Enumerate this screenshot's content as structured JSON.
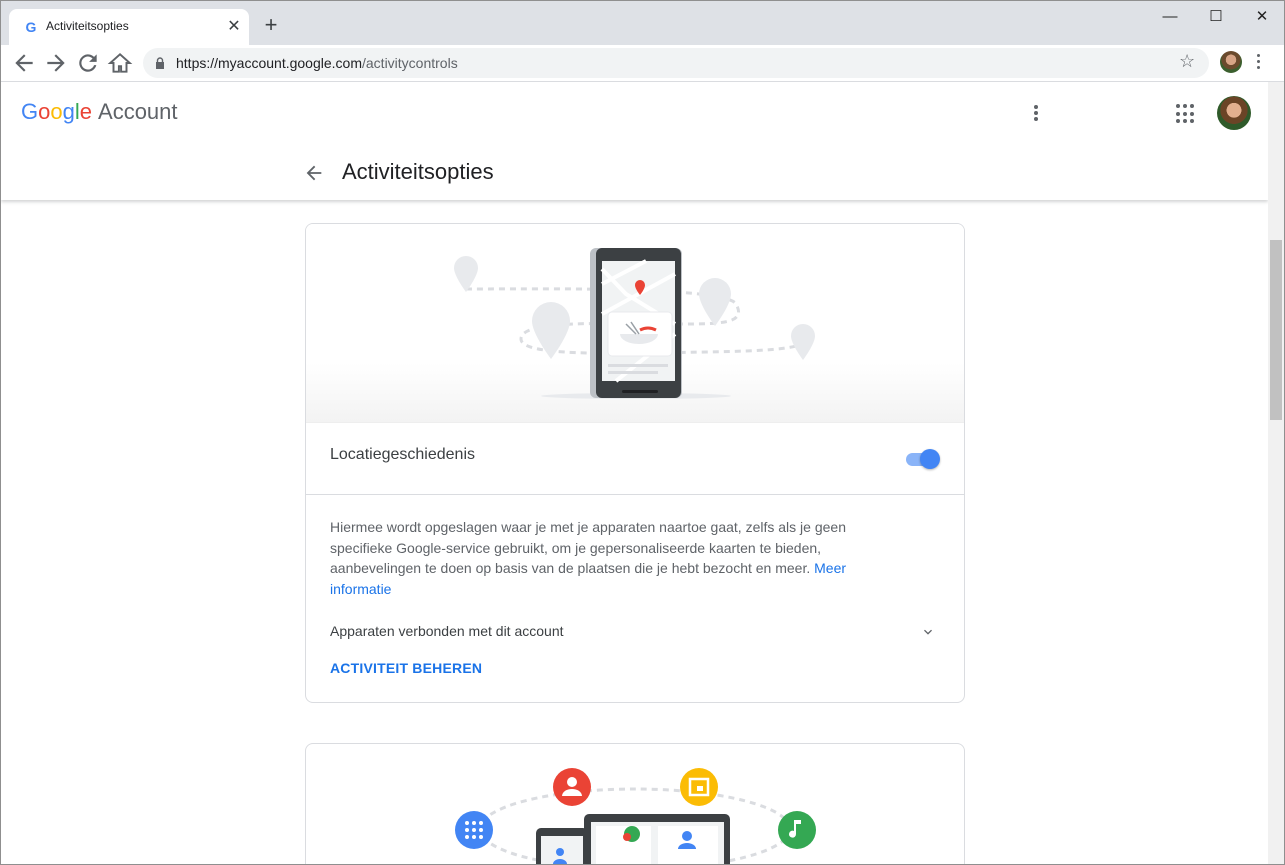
{
  "browser": {
    "tab_title": "Activiteitsopties",
    "tab_favicon": "G",
    "tab_close": "✕",
    "new_tab": "+",
    "window_controls": {
      "minimize": "—",
      "maximize": "☐",
      "close": "✕"
    },
    "url_host": "https://myaccount.google.com",
    "url_path": "/activitycontrols",
    "bookmark_icon": "☆"
  },
  "header": {
    "logo_letters": [
      "G",
      "o",
      "o",
      "g",
      "l",
      "e"
    ],
    "logo_suffix": "Account",
    "page_title": "Activiteitsopties"
  },
  "cards": {
    "location": {
      "title": "Locatiegeschiedenis",
      "toggle_on": true,
      "description": "Hiermee wordt opgeslagen waar je met je apparaten naartoe gaat, zelfs als je geen specifieke Google-service gebruikt, om je gepersonaliseerde kaarten te bieden, aanbevelingen te doen op basis van de plaatsen die je hebt bezocht en meer.",
      "more_link": "Meer informatie",
      "devices_label": "Apparaten verbonden met dit account",
      "manage_label": "ACTIVITEIT BEHEREN"
    }
  },
  "colors": {
    "accent": "#1a73e8",
    "toggle": "#4285f4",
    "icon_red": "#ea4335",
    "icon_yellow": "#fbbc05",
    "icon_blue": "#4285f4",
    "icon_green": "#34a853"
  }
}
